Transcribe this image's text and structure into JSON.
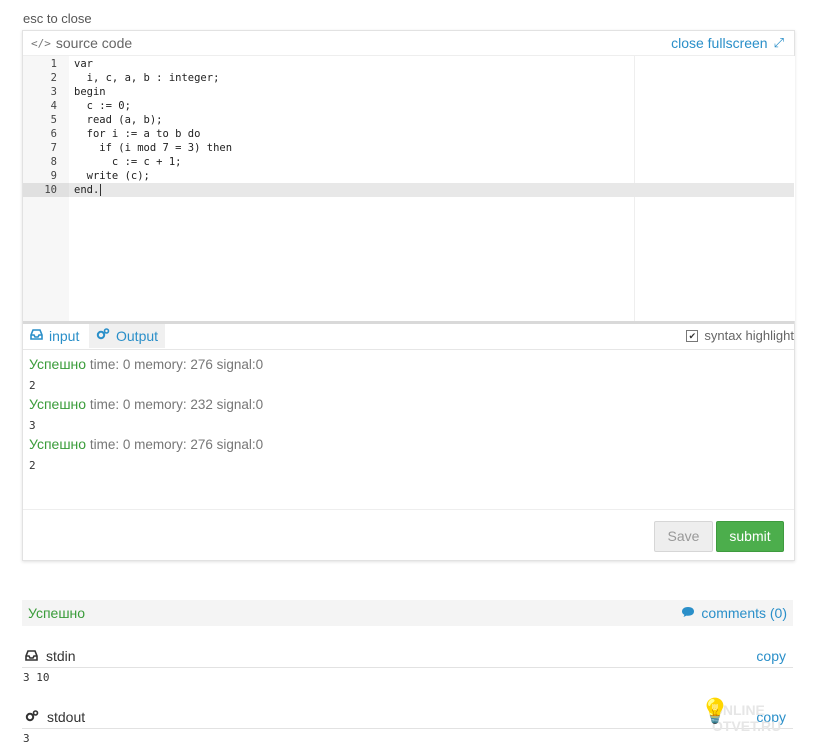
{
  "top": {
    "esc_hint": "esc to close"
  },
  "panel": {
    "source_label": "source code",
    "source_icon": "</>",
    "close_fullscreen": "close fullscreen",
    "fullscreen_icon": "⤢"
  },
  "code": {
    "lines": [
      {
        "num": "1",
        "text": "var"
      },
      {
        "num": "2",
        "text": "  i, c, a, b : integer;"
      },
      {
        "num": "3",
        "text": "begin"
      },
      {
        "num": "4",
        "text": "  c := 0;"
      },
      {
        "num": "5",
        "text": "  read (a, b);"
      },
      {
        "num": "6",
        "text": "  for i := a to b do"
      },
      {
        "num": "7",
        "text": "    if (i mod 7 = 3) then"
      },
      {
        "num": "8",
        "text": "      c := c + 1;"
      },
      {
        "num": "9",
        "text": "  write (c);"
      },
      {
        "num": "10",
        "text": "end."
      }
    ],
    "active_line": 10
  },
  "tabs": {
    "input_label": "input",
    "output_label": "Output",
    "syntax_label": "syntax highlight",
    "syntax_checked": "✔"
  },
  "results": [
    {
      "status": "Успешно",
      "meta": " time: 0 memory: 276 signal:0",
      "value": "2"
    },
    {
      "status": "Успешно",
      "meta": " time: 0 memory: 232 signal:0",
      "value": "3"
    },
    {
      "status": "Успешно",
      "meta": " time: 0 memory: 276 signal:0",
      "value": "2"
    }
  ],
  "buttons": {
    "save": "Save",
    "submit": "submit"
  },
  "result_bar": {
    "status": "Успешно",
    "comments": "comments (0)"
  },
  "stdin": {
    "title": "stdin",
    "copy": "copy",
    "value": "3 10"
  },
  "stdout": {
    "title": "stdout",
    "copy": "copy",
    "value": "3"
  },
  "watermark": {
    "line1": "ONLINE",
    "line2": "OTVET.RU"
  },
  "colors": {
    "accent": "#2a8fc9",
    "success": "#3a9c3a",
    "submit_bg": "#4cae4c"
  }
}
